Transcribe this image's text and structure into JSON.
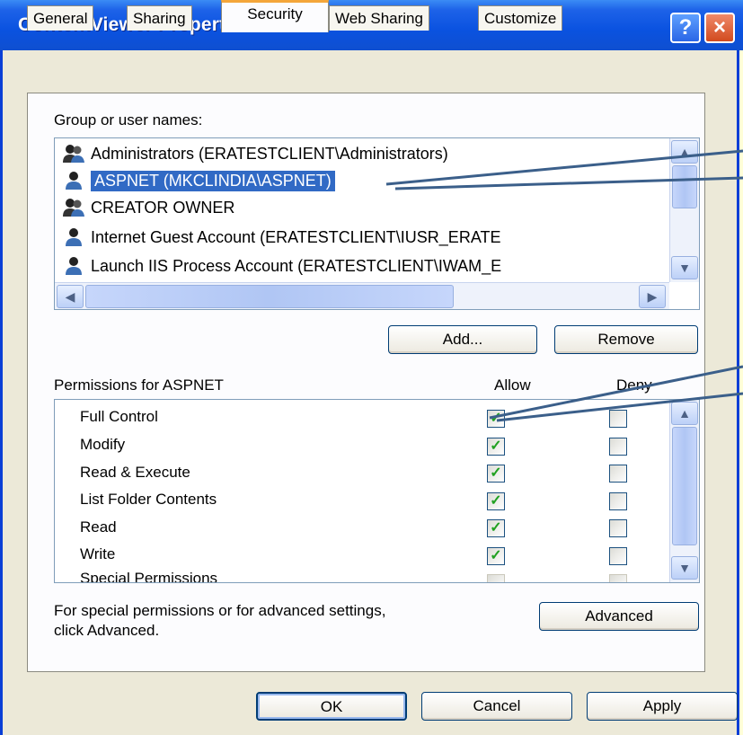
{
  "window": {
    "title": "ContentViewer Properties"
  },
  "title_buttons": {
    "help": "?",
    "close": "×"
  },
  "tabs": [
    {
      "label": "General",
      "active": false
    },
    {
      "label": "Sharing",
      "active": false
    },
    {
      "label": "Security",
      "active": true
    },
    {
      "label": "Web Sharing",
      "active": false
    },
    {
      "label": "Customize",
      "active": false
    }
  ],
  "groups": {
    "label": "Group or user names:",
    "items": [
      {
        "name": "Administrators (ERATESTCLIENT\\Administrators)",
        "icon": "group-icon",
        "selected": false
      },
      {
        "name": "ASPNET (MKCLINDIA\\ASPNET)",
        "icon": "user-icon",
        "selected": true
      },
      {
        "name": "CREATOR OWNER",
        "icon": "group-icon",
        "selected": false
      },
      {
        "name": "Internet Guest Account (ERATESTCLIENT\\IUSR_ERATE",
        "icon": "user-icon",
        "selected": false
      },
      {
        "name": "Launch IIS Process Account (ERATESTCLIENT\\IWAM_E",
        "icon": "user-icon",
        "selected": false
      }
    ]
  },
  "buttons": {
    "add": "Add...",
    "remove": "Remove",
    "advanced": "Advanced",
    "ok": "OK",
    "cancel": "Cancel",
    "apply": "Apply"
  },
  "permissions": {
    "label": "Permissions for ASPNET",
    "allow_header": "Allow",
    "deny_header": "Deny",
    "items": [
      {
        "name": "Full Control",
        "allow": true,
        "deny": false
      },
      {
        "name": "Modify",
        "allow": true,
        "deny": false
      },
      {
        "name": "Read & Execute",
        "allow": true,
        "deny": false
      },
      {
        "name": "List Folder Contents",
        "allow": true,
        "deny": false
      },
      {
        "name": "Read",
        "allow": true,
        "deny": false
      },
      {
        "name": "Write",
        "allow": true,
        "deny": false
      },
      {
        "name": "Special Permissions",
        "allow": false,
        "deny": false
      }
    ]
  },
  "advanced_note": {
    "line1": "For special permissions or for advanced settings,",
    "line2": "click Advanced."
  },
  "colors": {
    "titlebar": "#0a52e0",
    "selection": "#316ac5",
    "tab_highlight": "#f4a63a",
    "checkmark": "#21a121",
    "callout_line": "#3b5f8a"
  }
}
